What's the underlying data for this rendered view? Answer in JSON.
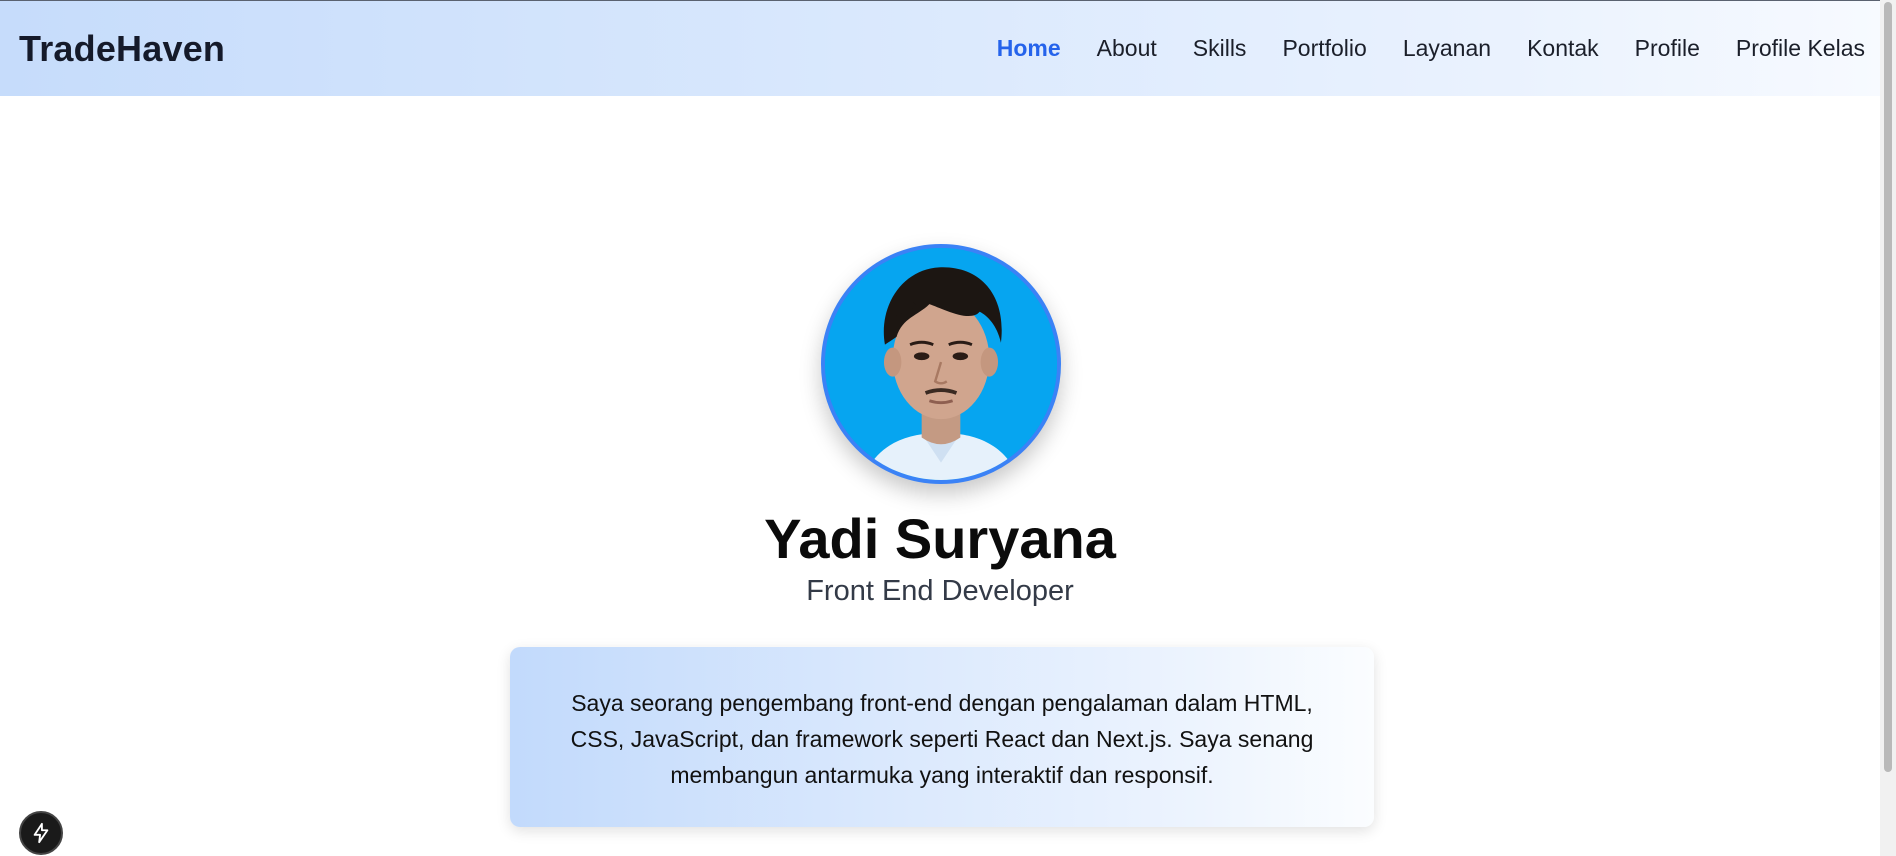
{
  "header": {
    "brand": "TradeHaven",
    "nav": [
      {
        "label": "Home",
        "active": true
      },
      {
        "label": "About",
        "active": false
      },
      {
        "label": "Skills",
        "active": false
      },
      {
        "label": "Portfolio",
        "active": false
      },
      {
        "label": "Layanan",
        "active": false
      },
      {
        "label": "Kontak",
        "active": false
      },
      {
        "label": "Profile",
        "active": false
      },
      {
        "label": "Profile Kelas",
        "active": false
      }
    ]
  },
  "hero": {
    "avatar_icon": "profile-photo",
    "name": "Yadi Suryana",
    "role": "Front End Developer",
    "bio": "Saya seorang pengembang front-end dengan pengalaman dalam HTML, CSS, JavaScript, dan framework seperti React dan Next.js. Saya senang membangun antarmuka yang interaktif dan responsif."
  },
  "dev_badge": {
    "icon": "lightning-bolt-icon"
  },
  "colors": {
    "accent": "#2563eb",
    "avatar_border": "#3b82f6",
    "avatar_background": "#06a5f0"
  }
}
